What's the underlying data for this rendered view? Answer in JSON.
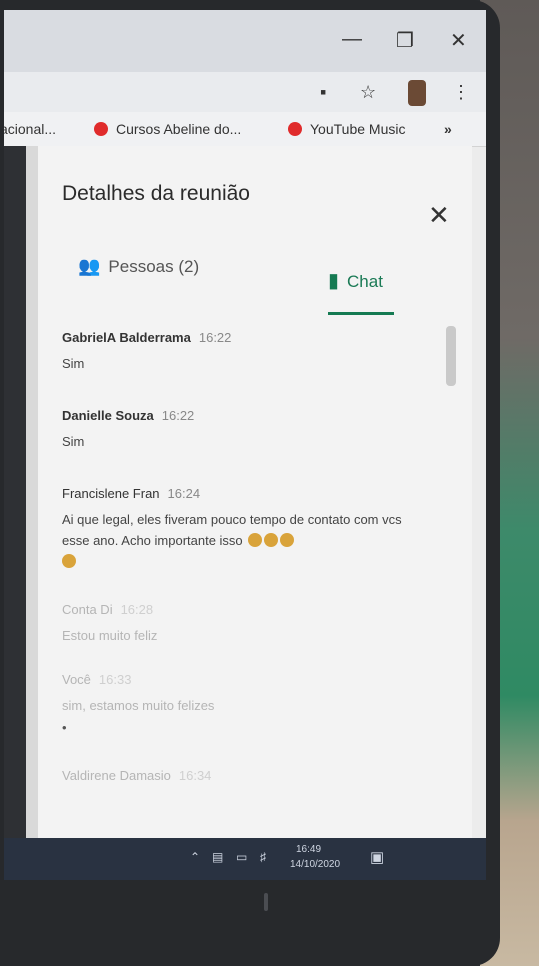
{
  "bookmarks": [
    {
      "label": "acional..."
    },
    {
      "label": "Cursos Abeline do..."
    },
    {
      "label": "YouTube Music"
    }
  ],
  "panel": {
    "title": "Detalhes da reunião",
    "tabs": [
      {
        "label": "Pessoas (2)",
        "icon": "people-icon"
      },
      {
        "label": "Chat",
        "icon": "chat-icon",
        "active": true
      }
    ]
  },
  "messages": [
    {
      "sender": "GabrielA Balderrama",
      "time": "16:22",
      "text": "Sim"
    },
    {
      "sender": "Danielle Souza",
      "time": "16:22",
      "text": "Sim"
    },
    {
      "sender": "Francislene Fran",
      "time": "16:24",
      "text": "Ai que legal, eles fiveram pouco tempo de contato com vcs esse ano. Acho importante isso"
    },
    {
      "sender": "Conta Di",
      "time": "16:28",
      "text": "Estou muito feliz"
    },
    {
      "sender": "Você",
      "time": "16:33",
      "text": "sim, estamos muito felizes"
    },
    {
      "sender": "Valdirene Damasio",
      "time": "16:34",
      "text": ""
    }
  ],
  "taskbar": {
    "time": "16:49",
    "date": "14/10/2020"
  },
  "colors": {
    "accent": "#157a52",
    "taskbar": "#293241"
  }
}
